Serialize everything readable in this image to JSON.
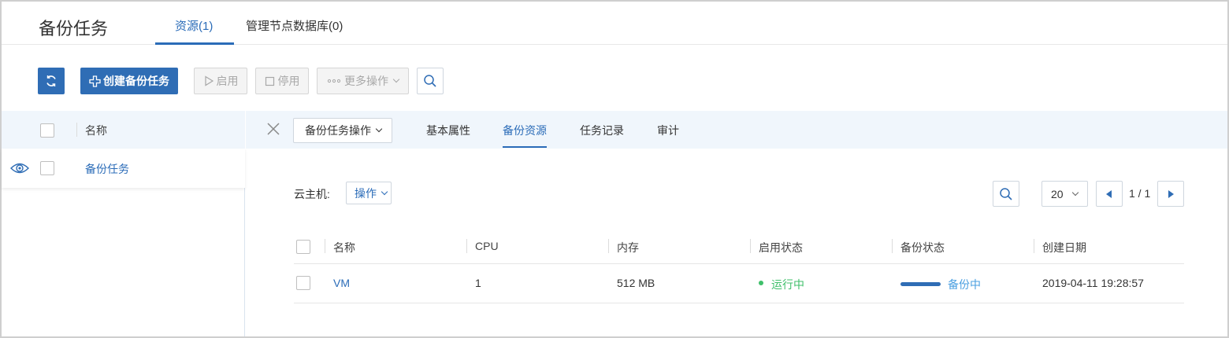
{
  "header": {
    "title": "备份任务",
    "tabs": [
      {
        "label": "资源(1)",
        "active": true
      },
      {
        "label": "管理节点数据库(0)",
        "active": false
      }
    ]
  },
  "toolbar": {
    "refresh_icon": "refresh-icon",
    "create_label": "创建备份任务",
    "enable_label": "启用",
    "disable_label": "停用",
    "more_label": "更多操作",
    "search_icon": "search-icon"
  },
  "left_list": {
    "column_name": "名称",
    "rows": [
      {
        "name": "备份任务",
        "previewing": true
      }
    ]
  },
  "detail": {
    "ops_label": "备份任务操作",
    "tabs": [
      {
        "label": "基本属性",
        "active": false
      },
      {
        "label": "备份资源",
        "active": true
      },
      {
        "label": "任务记录",
        "active": false
      },
      {
        "label": "审计",
        "active": false
      }
    ],
    "vm_label": "云主机:",
    "vm_op_label": "操作",
    "page_size": "20",
    "pagination": "1 / 1",
    "table": {
      "columns": [
        "名称",
        "CPU",
        "内存",
        "启用状态",
        "备份状态",
        "创建日期"
      ],
      "rows": [
        {
          "name": "VM",
          "cpu": "1",
          "memory": "512 MB",
          "enable_state": "运行中",
          "backup_state": "备份中",
          "created": "2019-04-11 19:28:57"
        }
      ]
    }
  },
  "colors": {
    "primary": "#2f6db5",
    "link": "#2b6cb8",
    "running": "#3fbf6a",
    "backup": "#4a9fe0",
    "header_bg": "#f0f6fc"
  }
}
